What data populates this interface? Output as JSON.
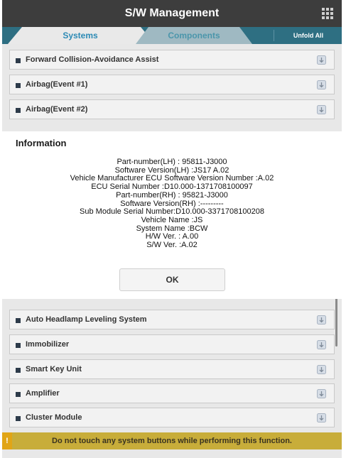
{
  "header": {
    "title": "S/W Management",
    "menu_icon": "grid-icon"
  },
  "tabs": {
    "systems": "Systems",
    "components": "Components",
    "unfold_all": "Unfold All"
  },
  "list_items": [
    "Forward Collision-Avoidance Assist",
    "Airbag(Event #1)",
    "Airbag(Event #2)",
    "Auto Headlamp Leveling System",
    "Immobilizer",
    "Smart Key Unit",
    "Amplifier",
    "Cluster Module"
  ],
  "dialog": {
    "title": "Information",
    "lines": [
      "Part-number(LH) : 95811-J3000",
      "Software Version(LH) :JS17   A.02",
      "Vehicle Manufacturer ECU Software Version Number :A.02",
      "ECU Serial Number :D10.000-1371708100097",
      "Part-number(RH) : 95821-J3000",
      "Software Version(RH) :---------",
      "Sub Module Serial Number:D10.000-3371708100208",
      "Vehicle Name :JS",
      "System Name :BCW",
      "H/W Ver. : A.00",
      "S/W Ver. :A.02"
    ],
    "ok_label": "OK"
  },
  "footer": {
    "warning_icon": "!",
    "message": "Do not touch any system buttons while performing this function."
  },
  "colors": {
    "header_bg": "#3d3d3d",
    "tab_bar": "#2e6f82",
    "active_tab": "#2c8ab5",
    "footer_bg": "#c8ad3a"
  }
}
